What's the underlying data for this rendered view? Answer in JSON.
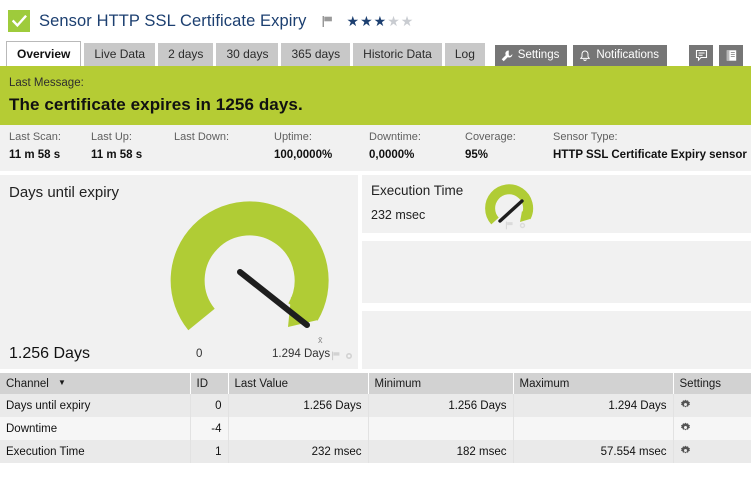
{
  "header": {
    "status_icon": "check-icon",
    "status_color": "#9ecb3b",
    "title": "Sensor HTTP SSL Certificate Expiry",
    "flag_icon": "flag-icon",
    "rating": {
      "filled": 3,
      "total": 5,
      "filled_color": "#1c3f70",
      "empty_color": "#c9ccd1"
    }
  },
  "tabs": [
    {
      "label": "Overview",
      "active": true
    },
    {
      "label": "Live Data",
      "active": false
    },
    {
      "label": "2 days",
      "active": false
    },
    {
      "label": "30 days",
      "active": false
    },
    {
      "label": "365 days",
      "active": false
    },
    {
      "label": "Historic Data",
      "active": false
    },
    {
      "label": "Log",
      "active": false
    }
  ],
  "toolbar": {
    "settings_label": "Settings",
    "settings_icon": "wrench-icon",
    "notifications_label": "Notifications",
    "notifications_icon": "bell-icon",
    "comments_icon": "comment-icon",
    "reports_icon": "report-icon"
  },
  "banner": {
    "label": "Last Message:",
    "message": "The certificate expires in 1256 days.",
    "color": "#b5cc34"
  },
  "status": [
    {
      "label": "Last Scan:",
      "value": "11 m 58 s"
    },
    {
      "label": "Last Up:",
      "value": "11 m 58 s"
    },
    {
      "label": "Last Down:",
      "value": ""
    },
    {
      "label": "Uptime:",
      "value": "100,0000%"
    },
    {
      "label": "Downtime:",
      "value": "0,0000%"
    },
    {
      "label": "Coverage:",
      "value": "95%"
    },
    {
      "label": "Sensor Type:",
      "value": "HTTP SSL Certificate Expiry sensor"
    }
  ],
  "main_gauge": {
    "title": "Days until expiry",
    "value_label": "1.256 Days",
    "min_label": "0",
    "max_label": "1.294 Days",
    "mean_marker": "x̄",
    "arc_color": "#b0cc35",
    "needle_color": "#1e1e1e"
  },
  "exec_gauge": {
    "title": "Execution Time",
    "value_label": "232 msec",
    "arc_color": "#b0cc35",
    "needle_color": "#1e1e1e"
  },
  "channel_table": {
    "columns": [
      "Channel",
      "ID",
      "Last Value",
      "Minimum",
      "Maximum",
      "Settings"
    ],
    "sorted_by": "Channel",
    "rows": [
      {
        "channel": "Days until expiry",
        "id": "0",
        "last_value": "1.256 Days",
        "minimum": "1.256 Days",
        "maximum": "1.294 Days",
        "settings_icon": "gear-icon"
      },
      {
        "channel": "Downtime",
        "id": "-4",
        "last_value": "",
        "minimum": "",
        "maximum": "",
        "settings_icon": "gear-icon"
      },
      {
        "channel": "Execution Time",
        "id": "1",
        "last_value": "232 msec",
        "minimum": "182 msec",
        "maximum": "57.554 msec",
        "settings_icon": "gear-icon"
      }
    ]
  },
  "chart_data": {
    "type": "gauge",
    "title": "Days until expiry",
    "value": 1256,
    "min": 0,
    "max": 1294,
    "unit": "Days",
    "secondary": {
      "title": "Execution Time",
      "value": 232,
      "min": 182,
      "max": 57554,
      "unit": "msec"
    }
  }
}
